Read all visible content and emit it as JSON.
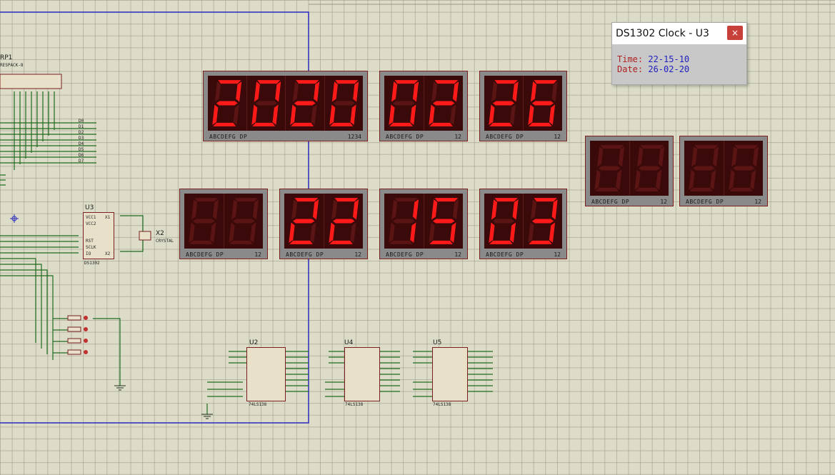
{
  "popup": {
    "title": "DS1302 Clock - U3",
    "close": "×",
    "time_label": "Time:",
    "time_value": "22-15-10",
    "date_label": "Date:",
    "date_value": "26-02-20"
  },
  "displays": [
    {
      "id": "year",
      "digits": "2020",
      "lbl": "ABCDEFG  DP",
      "lbl2": "1234"
    },
    {
      "id": "month",
      "digits": "02",
      "lbl": "ABCDEFG  DP",
      "lbl2": "12"
    },
    {
      "id": "day",
      "digits": "26",
      "lbl": "ABCDEFG  DP",
      "lbl2": "12"
    },
    {
      "id": "blank1",
      "digits": "  ",
      "lbl": "ABCDEFG  DP",
      "lbl2": "12"
    },
    {
      "id": "hour",
      "digits": "22",
      "lbl": "ABCDEFG  DP",
      "lbl2": "12"
    },
    {
      "id": "minute",
      "digits": "15",
      "lbl": "ABCDEFG  DP",
      "lbl2": "12"
    },
    {
      "id": "second",
      "digits": "03",
      "lbl": "ABCDEFG  DP",
      "lbl2": "12"
    },
    {
      "id": "blank2",
      "digits": "  ",
      "lbl": "ABCDEFG  DP",
      "lbl2": "12"
    },
    {
      "id": "blank3",
      "digits": "  ",
      "lbl": "ABCDEFG  DP",
      "lbl2": "12"
    }
  ],
  "components": {
    "rp1": {
      "ref": "RP1",
      "part": "RESPACK-8"
    },
    "u3": {
      "ref": "U3",
      "part": "DS1302",
      "pins": [
        "VCC1",
        "VCC2",
        "RST",
        "SCLK",
        "IO",
        "X1",
        "X2"
      ]
    },
    "x2": {
      "ref": "X2",
      "part": "CRYSTAL"
    },
    "u2": {
      "ref": "U2",
      "part": "74LS138"
    },
    "u4": {
      "ref": "U4",
      "part": "74LS138"
    },
    "u5": {
      "ref": "U5",
      "part": "74LS138"
    }
  },
  "bus_labels": [
    "D0",
    "D1",
    "D2",
    "D3",
    "D4",
    "D5",
    "D6",
    "D7"
  ],
  "colors": {
    "segment_on": "#ff1a1a",
    "segment_off": "#5a1414",
    "wire": "#1f6b1f",
    "frame": "#2a2ac0"
  }
}
